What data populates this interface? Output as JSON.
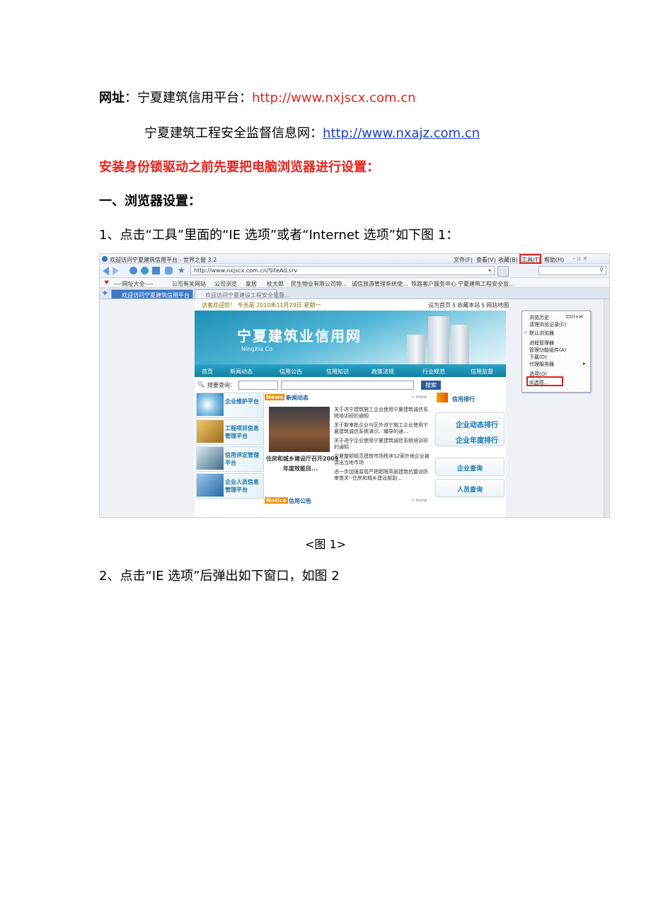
{
  "doc": {
    "line1_label": "网址",
    "line1_colon": "：",
    "line1_text": "宁夏建筑信用平台：",
    "line1_url": "http://www.nxjscx.com.cn",
    "line2_text": "宁夏建筑工程安全监督信息网：",
    "line2_url": "http://www.nxajz.com.cn",
    "warning": "安装身份锁驱动之前先要把电脑浏览器进行设置：",
    "section1": "一、浏览器设置：",
    "step1": "1、点击“工具”里面的“IE 选项”或者“Internet  选项”如下图 1：",
    "caption1": "<图 1>",
    "step2": "2、点击“IE 选项”后弹出如下窗口，如图 2"
  },
  "browser": {
    "window_title": "欢迎访问宁夏建筑信用平台 - 世界之窗 3.2",
    "menus": [
      "文件(F)",
      "查看(V)",
      "收藏(B)",
      "工具(T)",
      "帮助(H)"
    ],
    "address": "http://www.nxjscx.com.cn/SiteAd.srv",
    "favorites": [
      "----网址大全----",
      "公司有关网站",
      "公司浏览",
      "家居",
      "枕大郎",
      "民生物业有限公司物...",
      "诚信旅游管理系统使...",
      "铁路客户服务中心",
      "宁夏建筑工程安全监..."
    ],
    "tabs": [
      "欢迎访问宁夏建筑信用平台",
      "欢迎访问宁夏建设工程安全监督..."
    ],
    "tools_menu": {
      "items": [
        "浏览历史",
        "清理浏览记录(C)",
        "默认浏览器",
        "进程管理器",
        "管理功能组件(A)",
        "下载(D)",
        "代理服务器",
        "选项(O)",
        "IE选项..."
      ],
      "shortcut": "Ctrl+H",
      "highlight_color": "#e0231c"
    }
  },
  "site": {
    "welcome": "访客欢迎您！ 今天是 2010年11月29日 星期一",
    "top_links": "设为首页 § 收藏本站 § 网站地图",
    "banner_title": "宁夏建筑业信用网",
    "banner_sub": "NingXia Co",
    "nav": [
      "首页",
      "新闻动态",
      "信用公告",
      "信用知识",
      "政策法规",
      "行业规范",
      "信用监督"
    ],
    "query_label": "搜要查询：",
    "search_btn": "搜索",
    "left_boxes": [
      "企业维护平台",
      "工程项目信息管理平台",
      "信用评定管理平台",
      "企业人员信息管理平台"
    ],
    "news_title": "新闻动态",
    "news_tag": "News",
    "more": "» more",
    "news_items": [
      "关于进宁建筑施工企业使用宁夏建筑诚信系统培训班的通知",
      "关于新审批企业与区外进宁施工企业使用宁夏建筑诚信系统演示、辅导的通...",
      "关于进宁企业使用宁夏建筑诚信系统培训班的通知",
      "宁夏整顿规范建筑市场秩序12家外地企业被清出当地市场",
      "进一步加强监管严把超限高层建筑抗震设防审查关--住房和城乡建设部副..."
    ],
    "photo_caption1": "住房和城乡建设厅召开2009",
    "photo_caption2": "年度效能目...",
    "notice_tag": "Notice",
    "notice_title": "信用公告",
    "rank_title": "信用排行",
    "right_buttons": [
      "企业动态排行",
      "企业年度排行",
      "企业查询",
      "人员查询"
    ]
  }
}
